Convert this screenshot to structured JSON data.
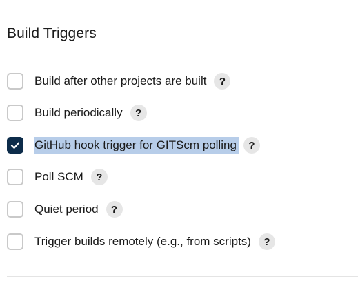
{
  "section": {
    "title": "Build Triggers"
  },
  "triggers": [
    {
      "label": "Build after other projects are built",
      "checked": false,
      "help": "?"
    },
    {
      "label": "Build periodically",
      "checked": false,
      "help": "?"
    },
    {
      "label": "GitHub hook trigger for GITScm polling",
      "checked": true,
      "help": "?"
    },
    {
      "label": "Poll SCM",
      "checked": false,
      "help": "?"
    },
    {
      "label": "Quiet period",
      "checked": false,
      "help": "?"
    },
    {
      "label": "Trigger builds remotely (e.g., from scripts)",
      "checked": false,
      "help": "?"
    }
  ],
  "colors": {
    "checked_fill": "#0d2c4a",
    "selection_highlight": "#b7cde9",
    "help_bg": "#e6e6e6"
  },
  "icons": {
    "checkmark": "check-icon",
    "help": "question-mark-icon"
  }
}
